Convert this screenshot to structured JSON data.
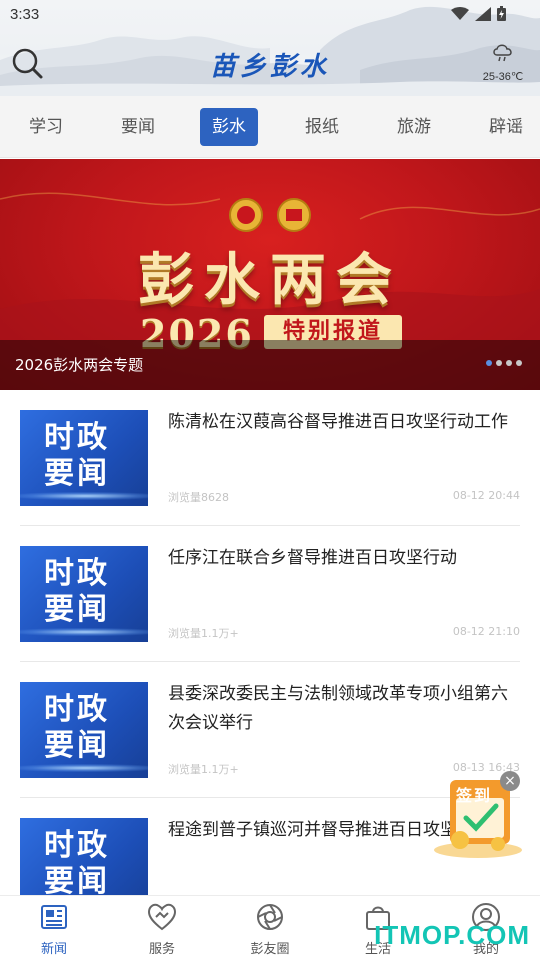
{
  "status_bar": {
    "time": "3:33"
  },
  "header": {
    "brand": "苗乡彭水",
    "weather": {
      "icon": "cloud-rain-icon",
      "temperature": "25-36℃"
    }
  },
  "tabs": [
    {
      "label": "学习",
      "active": false
    },
    {
      "label": "要闻",
      "active": false
    },
    {
      "label": "彭水",
      "active": true
    },
    {
      "label": "报纸",
      "active": false
    },
    {
      "label": "旅游",
      "active": false
    },
    {
      "label": "辟谣",
      "active": false
    }
  ],
  "banner": {
    "headline": "彭水两会",
    "year": "2026",
    "tag": "特别报道",
    "caption": "2026彭水两会专题",
    "slide_count": 4,
    "active_slide": 1
  },
  "news": [
    {
      "thumb_line1": "时政",
      "thumb_line2": "要闻",
      "title": "陈清松在汉葭高谷督导推进百日攻坚行动工作",
      "views": "浏览量8628",
      "time": "08-12 20:44"
    },
    {
      "thumb_line1": "时政",
      "thumb_line2": "要闻",
      "title": "任序江在联合乡督导推进百日攻坚行动",
      "views": "浏览量1.1万+",
      "time": "08-12 21:10"
    },
    {
      "thumb_line1": "时政",
      "thumb_line2": "要闻",
      "title": "县委深改委民主与法制领域改革专项小组第六次会议举行",
      "views": "浏览量1.1万+",
      "time": "08-13 16:43"
    },
    {
      "thumb_line1": "时政",
      "thumb_line2": "要闻",
      "title": "程途到普子镇巡河并督导推进百日攻坚行动",
      "views": "",
      "time": ""
    }
  ],
  "floating_signin": {
    "label": "签到",
    "close": "×"
  },
  "bottom_nav": [
    {
      "label": "新闻",
      "icon": "newspaper-icon",
      "active": true
    },
    {
      "label": "服务",
      "icon": "handshake-icon",
      "active": false
    },
    {
      "label": "彭友圈",
      "icon": "aperture-icon",
      "active": false
    },
    {
      "label": "生活",
      "icon": "shopping-bag-icon",
      "active": false
    },
    {
      "label": "我的",
      "icon": "user-icon",
      "active": false
    }
  ],
  "watermark": "ITMOP.COM",
  "colors": {
    "accent": "#2d63c0",
    "banner_red": "#c1171b",
    "gold": "#fbe7b0"
  }
}
